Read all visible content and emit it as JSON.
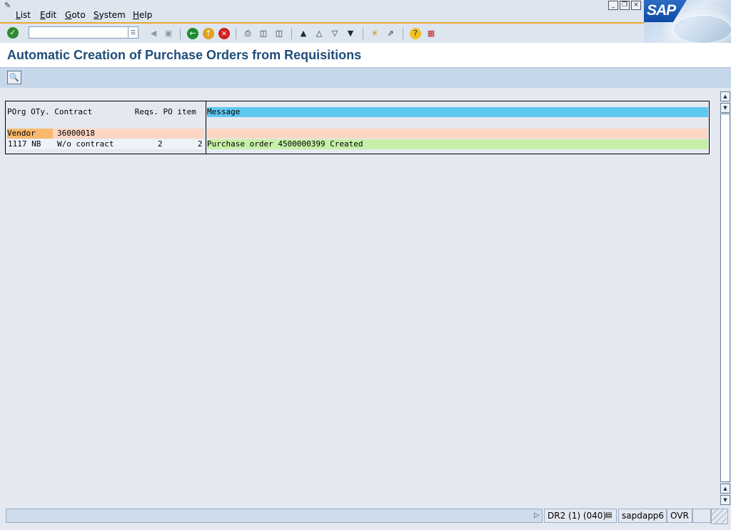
{
  "menu": {
    "items": [
      {
        "label": "List",
        "underline": "L",
        "rest": "ist"
      },
      {
        "label": "Edit",
        "underline": "E",
        "rest": "dit"
      },
      {
        "label": "Goto",
        "underline": "G",
        "rest": "oto"
      },
      {
        "label": "System",
        "underline": "S",
        "rest": "ystem"
      },
      {
        "label": "Help",
        "underline": "H",
        "rest": "elp"
      }
    ],
    "logo_text": "SAP"
  },
  "toolbar": {
    "command_value": "",
    "icons": [
      "ok-icon",
      "back-icon",
      "exit-icon",
      "cancel-icon",
      "print-icon",
      "find-icon",
      "find-next-icon",
      "first-page-icon",
      "previous-page-icon",
      "next-page-icon",
      "last-page-icon",
      "create-session-icon",
      "shortcut-icon",
      "help-icon",
      "layout-icon"
    ]
  },
  "title": "Automatic Creation of Purchase Orders from Requisitions",
  "list": {
    "header_left": "POrg OTy. Contract         Reqs. PO item",
    "header_right": "Message",
    "vendor_label": "Vendor",
    "vendor_value": "36000018",
    "row_porg_oty": "1117 NB",
    "row_contract": "W/o contract",
    "row_reqs": "2",
    "row_po_item": "2",
    "row_message": "Purchase order 4500000399 Created"
  },
  "status": {
    "system": "DR2 (1) (040)",
    "server": "sapdapp6",
    "mode": "OVR"
  },
  "colors": {
    "header_message": "#5fc8f0",
    "vendor_row": "#fbd7c3",
    "vendor_label": "#f9b86e",
    "success_row": "#c6f0a8",
    "title": "#1f4d7a",
    "toolbar_accent": "#f0a630"
  }
}
